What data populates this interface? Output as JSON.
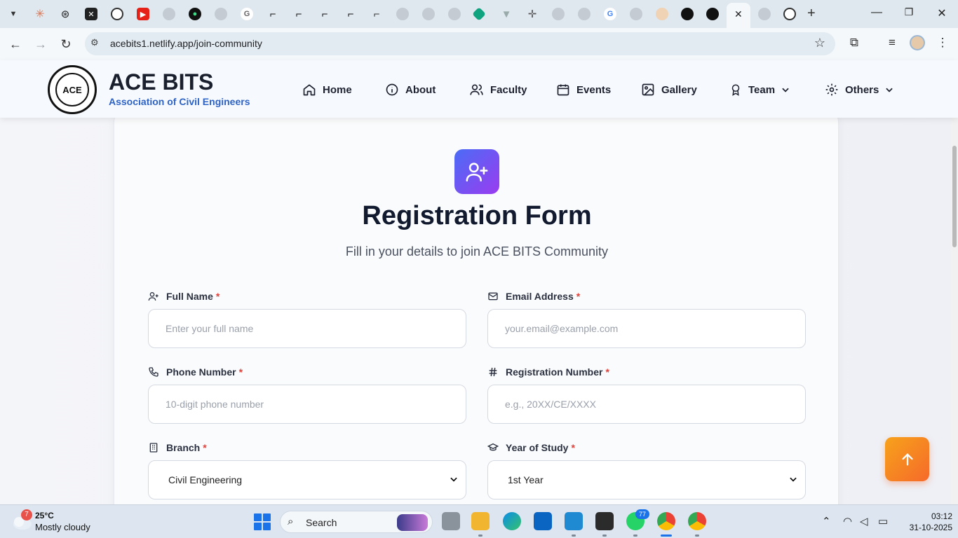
{
  "browser": {
    "url": "acebits1.netlify.app/join-community"
  },
  "site": {
    "title": "ACE BITS",
    "subtitle": "Association of Civil Engineers",
    "logo_text": "ACE",
    "nav": [
      {
        "label": "Home",
        "icon": "home-icon"
      },
      {
        "label": "About",
        "icon": "info-icon"
      },
      {
        "label": "Faculty",
        "icon": "users-icon"
      },
      {
        "label": "Events",
        "icon": "calendar-icon"
      },
      {
        "label": "Gallery",
        "icon": "image-icon"
      },
      {
        "label": "Team",
        "icon": "award-icon",
        "dropdown": true
      },
      {
        "label": "Others",
        "icon": "gear-icon",
        "dropdown": true
      }
    ]
  },
  "form": {
    "title": "Registration Form",
    "subtitle": "Fill in your details to join ACE BITS Community",
    "required_mark": "*",
    "fields": {
      "full_name": {
        "label": "Full Name",
        "placeholder": "Enter your full name"
      },
      "email": {
        "label": "Email Address",
        "placeholder": "your.email@example.com"
      },
      "phone": {
        "label": "Phone Number",
        "placeholder": "10-digit phone number"
      },
      "reg_no": {
        "label": "Registration Number",
        "placeholder": "e.g., 20XX/CE/XXXX"
      },
      "branch": {
        "label": "Branch",
        "value": "Civil Engineering"
      },
      "year": {
        "label": "Year of Study",
        "value": "1st Year"
      }
    }
  },
  "taskbar": {
    "weather_temp": "25°C",
    "weather_desc": "Mostly cloudy",
    "weather_badge": "7",
    "search_label": "Search",
    "whatsapp_badge": "77",
    "time": "03:12",
    "date": "31-10-2025"
  },
  "colors": {
    "brand_blue": "#2e63c6",
    "form_icon_gradient": [
      "#4b6cf6",
      "#9a3cf0"
    ],
    "scroll_top_gradient": [
      "#f7a21b",
      "#f66a2a"
    ],
    "required": "#e0413a"
  }
}
